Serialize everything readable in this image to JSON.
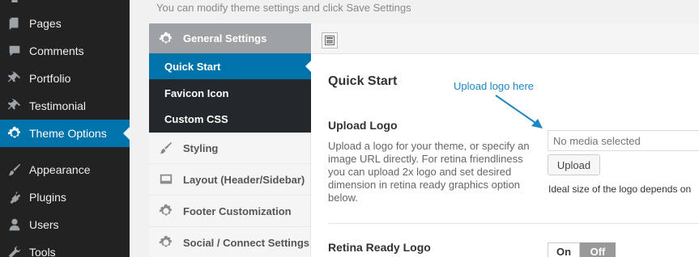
{
  "notice": "You can modify theme settings and click Save Settings",
  "wp_menu": [
    {
      "label": "Pages",
      "icon": "pages-icon",
      "active": false
    },
    {
      "label": "Comments",
      "icon": "comments-icon",
      "active": false
    },
    {
      "label": "Portfolio",
      "icon": "pin-icon",
      "active": false
    },
    {
      "label": "Testimonial",
      "icon": "pin-icon",
      "active": false
    },
    {
      "label": "Theme Options",
      "icon": "gear-icon",
      "active": true
    },
    {
      "label": "Appearance",
      "icon": "brush-icon",
      "active": false
    },
    {
      "label": "Plugins",
      "icon": "plug-icon",
      "active": false
    },
    {
      "label": "Users",
      "icon": "user-icon",
      "active": false
    },
    {
      "label": "Tools",
      "icon": "wrench-icon",
      "active": false
    }
  ],
  "options_nav": {
    "header": "General Settings",
    "subitems": [
      "Quick Start",
      "Favicon Icon",
      "Custom CSS"
    ],
    "items": [
      {
        "label": "Styling",
        "icon": "brush-icon"
      },
      {
        "label": "Layout (Header/Sidebar)",
        "icon": "layout-icon"
      },
      {
        "label": "Footer Customization",
        "icon": "gear-icon"
      },
      {
        "label": "Social / Connect Settings",
        "icon": "gear-icon"
      }
    ]
  },
  "content": {
    "title": "Quick Start",
    "hint": "Upload logo here",
    "upload_logo": {
      "title": "Upload Logo",
      "description": "Upload a logo for your theme, or specify an image URL directly. For retina friendliness you can upload 2x logo and set desired dimension in retina ready graphics option below.",
      "placeholder": "No media selected",
      "button": "Upload",
      "note": "Ideal size of the logo depends on"
    },
    "retina_logo": {
      "title": "Retina Ready Logo",
      "on_label": "On",
      "off_label": "Off"
    }
  },
  "colors": {
    "accent": "#0073aa",
    "hint": "#1e87c2"
  }
}
